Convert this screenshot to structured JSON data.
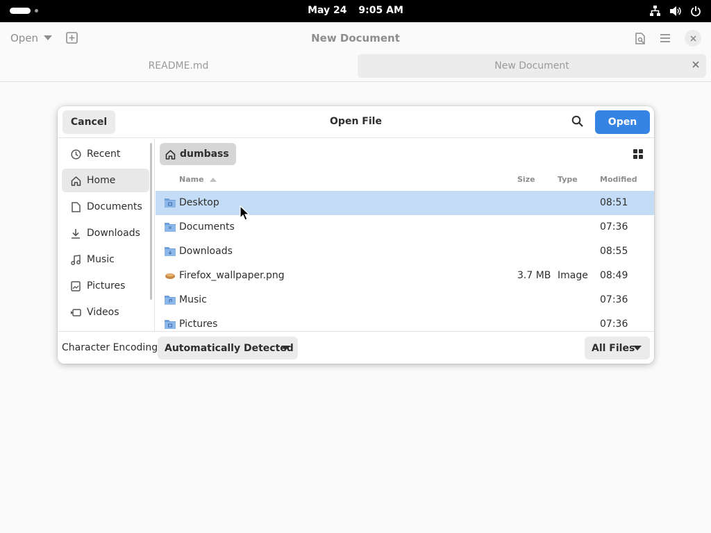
{
  "topbar": {
    "date": "May 24",
    "time": "9:05 AM"
  },
  "app": {
    "open_label": "Open",
    "title": "New Document",
    "tabs": [
      {
        "label": "README.md"
      },
      {
        "label": "New Document"
      }
    ]
  },
  "dialog": {
    "title": "Open File",
    "cancel_label": "Cancel",
    "open_label": "Open",
    "sidebar": [
      {
        "label": "Recent",
        "icon": "clock-icon"
      },
      {
        "label": "Home",
        "icon": "home-icon"
      },
      {
        "label": "Documents",
        "icon": "document-icon"
      },
      {
        "label": "Downloads",
        "icon": "download-icon"
      },
      {
        "label": "Music",
        "icon": "music-icon"
      },
      {
        "label": "Pictures",
        "icon": "picture-icon"
      },
      {
        "label": "Videos",
        "icon": "video-icon"
      }
    ],
    "selected_sidebar_item": "Home",
    "breadcrumb": "dumbass",
    "columns": {
      "name": "Name",
      "size": "Size",
      "type": "Type",
      "modified": "Modified"
    },
    "files": [
      {
        "name": "Desktop",
        "size": "",
        "type": "",
        "modified": "08:51",
        "icon": "folder-icon"
      },
      {
        "name": "Documents",
        "size": "",
        "type": "",
        "modified": "07:36",
        "icon": "folder-icon"
      },
      {
        "name": "Downloads",
        "size": "",
        "type": "",
        "modified": "08:55",
        "icon": "folder-icon"
      },
      {
        "name": "Firefox_wallpaper.png",
        "size": "3.7 MB",
        "type": "Image",
        "modified": "08:49",
        "icon": "image-file-icon"
      },
      {
        "name": "Music",
        "size": "",
        "type": "",
        "modified": "07:36",
        "icon": "folder-icon"
      },
      {
        "name": "Pictures",
        "size": "",
        "type": "",
        "modified": "07:36",
        "icon": "folder-icon"
      }
    ],
    "selected_file": "Desktop",
    "footer": {
      "encoding_label": "Character Encoding:",
      "encoding_value": "Automatically Detected",
      "filter_value": "All Files"
    }
  },
  "colors": {
    "accent": "#3584e4",
    "selection": "#c4dcf5",
    "topbar": "#000000",
    "folder": "#6fa0dc"
  }
}
